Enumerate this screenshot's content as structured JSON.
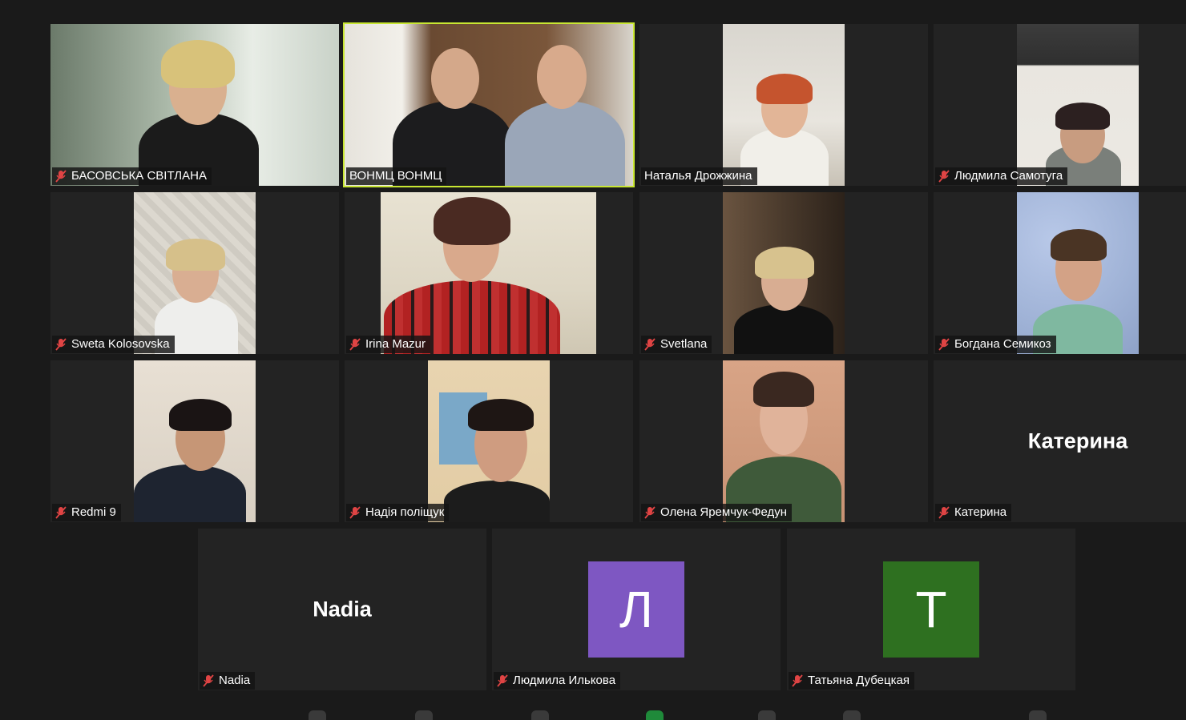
{
  "participants": [
    {
      "name": "БАСОВСЬКА СВІТЛАНА",
      "muted": true,
      "active": false,
      "video": true
    },
    {
      "name": "ВОНМЦ ВОНМЦ",
      "muted": false,
      "active": true,
      "video": true
    },
    {
      "name": "Наталья Дрожжина",
      "muted": false,
      "active": false,
      "video": true
    },
    {
      "name": "Людмила Самотуга",
      "muted": true,
      "active": false,
      "video": true
    },
    {
      "name": "Sweta Kolosovska",
      "muted": true,
      "active": false,
      "video": true
    },
    {
      "name": "Irina Mazur",
      "muted": true,
      "active": false,
      "video": true
    },
    {
      "name": "Svetlana",
      "muted": true,
      "active": false,
      "video": true
    },
    {
      "name": "Богдана Семикоз",
      "muted": true,
      "active": false,
      "video": true
    },
    {
      "name": "Redmi 9",
      "muted": true,
      "active": false,
      "video": true
    },
    {
      "name": "Надія поліщук",
      "muted": true,
      "active": false,
      "video": true
    },
    {
      "name": "Олена Яремчук-Федун",
      "muted": true,
      "active": false,
      "video": true
    },
    {
      "name": "Катерина",
      "muted": true,
      "active": false,
      "video": false,
      "display_name": "Катерина"
    },
    {
      "name": "Nadia",
      "muted": true,
      "active": false,
      "video": false,
      "display_name": "Nadia"
    },
    {
      "name": "Людмила Илькова",
      "muted": true,
      "active": false,
      "video": false,
      "avatar_letter": "Л",
      "avatar_color": "#7e57c2"
    },
    {
      "name": "Татьяна Дубецкая",
      "muted": true,
      "active": false,
      "video": false,
      "avatar_letter": "Т",
      "avatar_color": "#2e7020"
    }
  ],
  "colors": {
    "active_speaker": "#c8e632",
    "muted_icon": "#e04444",
    "background": "#1a1a1a",
    "tile": "#232323"
  }
}
